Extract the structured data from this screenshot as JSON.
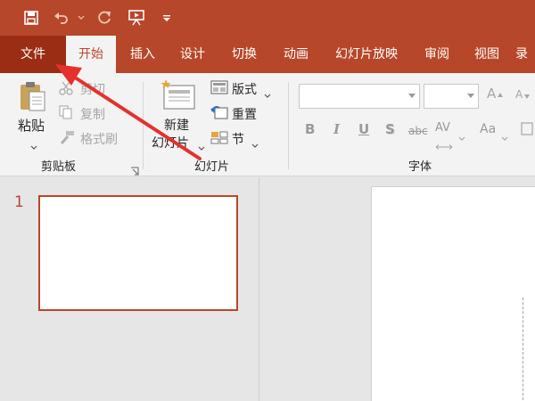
{
  "tabs": {
    "file": "文件",
    "home": "开始",
    "insert": "插入",
    "design": "设计",
    "transitions": "切换",
    "animations": "动画",
    "slideshow": "幻灯片放映",
    "review": "审阅",
    "view": "视图",
    "record": "录"
  },
  "clipboard": {
    "paste": "粘贴",
    "cut": "剪切",
    "copy": "复制",
    "format_painter": "格式刷",
    "group_label": "剪贴板"
  },
  "slides": {
    "new_slide_line1": "新建",
    "new_slide_line2": "幻灯片",
    "layout": "版式",
    "reset": "重置",
    "section": "节",
    "group_label": "幻灯片"
  },
  "font": {
    "bold": "B",
    "italic": "I",
    "underline": "U",
    "shadow": "S",
    "strike": "abc",
    "spacing": "AV",
    "case": "Aa",
    "grow": "A",
    "shrink": "A",
    "group_label": "字体"
  },
  "thumbnails": {
    "slide_number": "1"
  },
  "colors": {
    "accent": "#b7472a",
    "file_tab": "#9a2d14",
    "annotation_arrow": "#e5312b"
  }
}
